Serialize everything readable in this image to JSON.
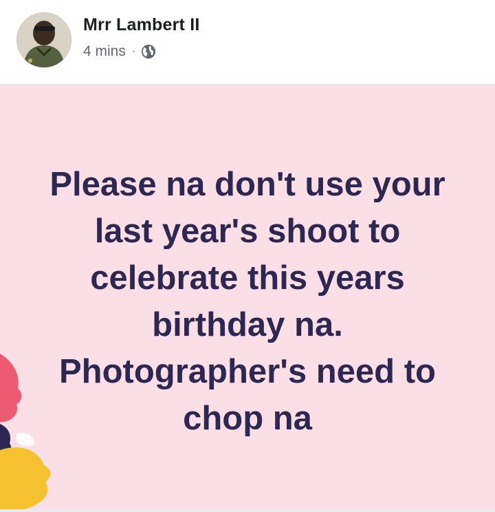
{
  "post": {
    "author": "Mrr Lambert II",
    "time": "4 mins",
    "separator": "·",
    "audience_icon": "globe-icon",
    "lines": [
      "Please na don't use your",
      "last year's shoot to",
      "celebrate this years",
      "birthday na.",
      "Photographer's need to",
      "chop na"
    ]
  },
  "colors": {
    "background_pink": "#fbdfe6",
    "text_dark": "#2e2752",
    "deco_red": "#ee5a72",
    "deco_yellow": "#f6c12e",
    "deco_navy": "#2e2752"
  }
}
